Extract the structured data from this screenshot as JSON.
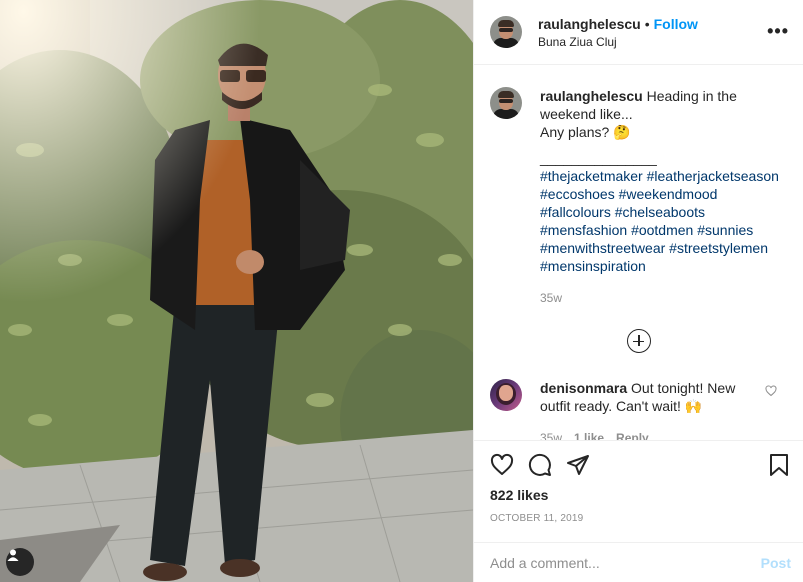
{
  "post": {
    "username": "raulanghelescu",
    "separator": "•",
    "follow_label": "Follow",
    "location": "Buna Ziua Cluj",
    "more_label": "•••"
  },
  "caption": {
    "username": "raulanghelescu",
    "line1": "Heading in the weekend like...",
    "line2": "Any plans? 🤔",
    "divider": "_______________",
    "hashtags": [
      "#thejacketmaker",
      "#leatherjacketseason",
      "#eccoshoes",
      "#weekendmood",
      "#fallcolours",
      "#chelseaboots",
      "#mensfashion",
      "#ootdmen",
      "#sunnies",
      "#menwithstreetwear",
      "#streetstylemen",
      "#mensinspiration"
    ],
    "age": "35w"
  },
  "comment": {
    "username": "denisonmara",
    "text": "Out tonight! New outfit ready. Can't wait! 🙌",
    "age": "35w",
    "likes": "1 like",
    "reply_label": "Reply"
  },
  "engagement": {
    "likes": "822 likes",
    "date": "October 11, 2019"
  },
  "composer": {
    "placeholder": "Add a comment...",
    "post_label": "Post"
  },
  "icons": {
    "like": "heart-icon",
    "comment": "comment-bubble-icon",
    "share": "paper-plane-icon",
    "save": "bookmark-icon",
    "more": "more-options-icon",
    "load": "load-more-comments-icon",
    "tag": "user-tags-icon"
  },
  "colors": {
    "accent": "#0095f6",
    "hashtag": "#00376b",
    "muted": "#8e8e8e",
    "post_disabled": "#b2dffc"
  }
}
